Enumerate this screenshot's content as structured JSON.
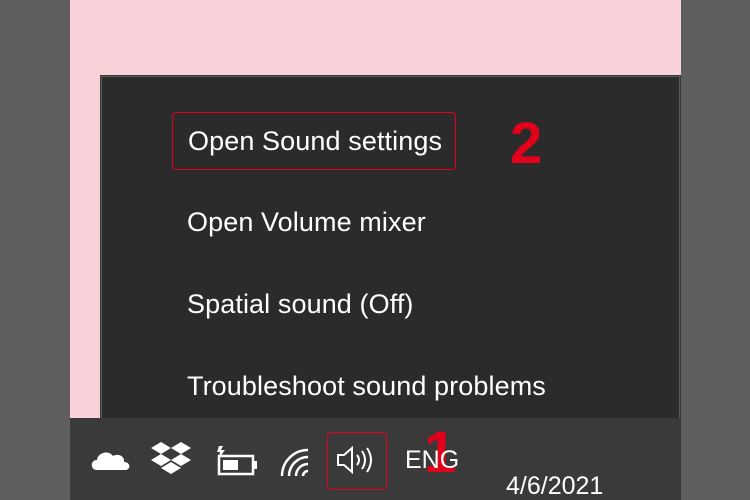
{
  "context_menu": {
    "items": [
      {
        "label": "Open Sound settings"
      },
      {
        "label": "Open Volume mixer"
      },
      {
        "label": "Spatial sound (Off)"
      },
      {
        "label": "Troubleshoot sound problems"
      }
    ]
  },
  "annotations": {
    "step1": "1",
    "step2": "2"
  },
  "taskbar": {
    "language": "ENG",
    "date": "4/6/2021",
    "icons": [
      "cloud-icon",
      "dropbox-icon",
      "battery-icon",
      "wifi-icon",
      "speaker-icon"
    ]
  },
  "colors": {
    "highlight": "#e3001b",
    "menu_bg": "#2b2b2b",
    "taskbar_bg": "#3a3a3a",
    "desktop_bg": "#f9d2d9",
    "frame_bg": "#5e5e5e"
  }
}
